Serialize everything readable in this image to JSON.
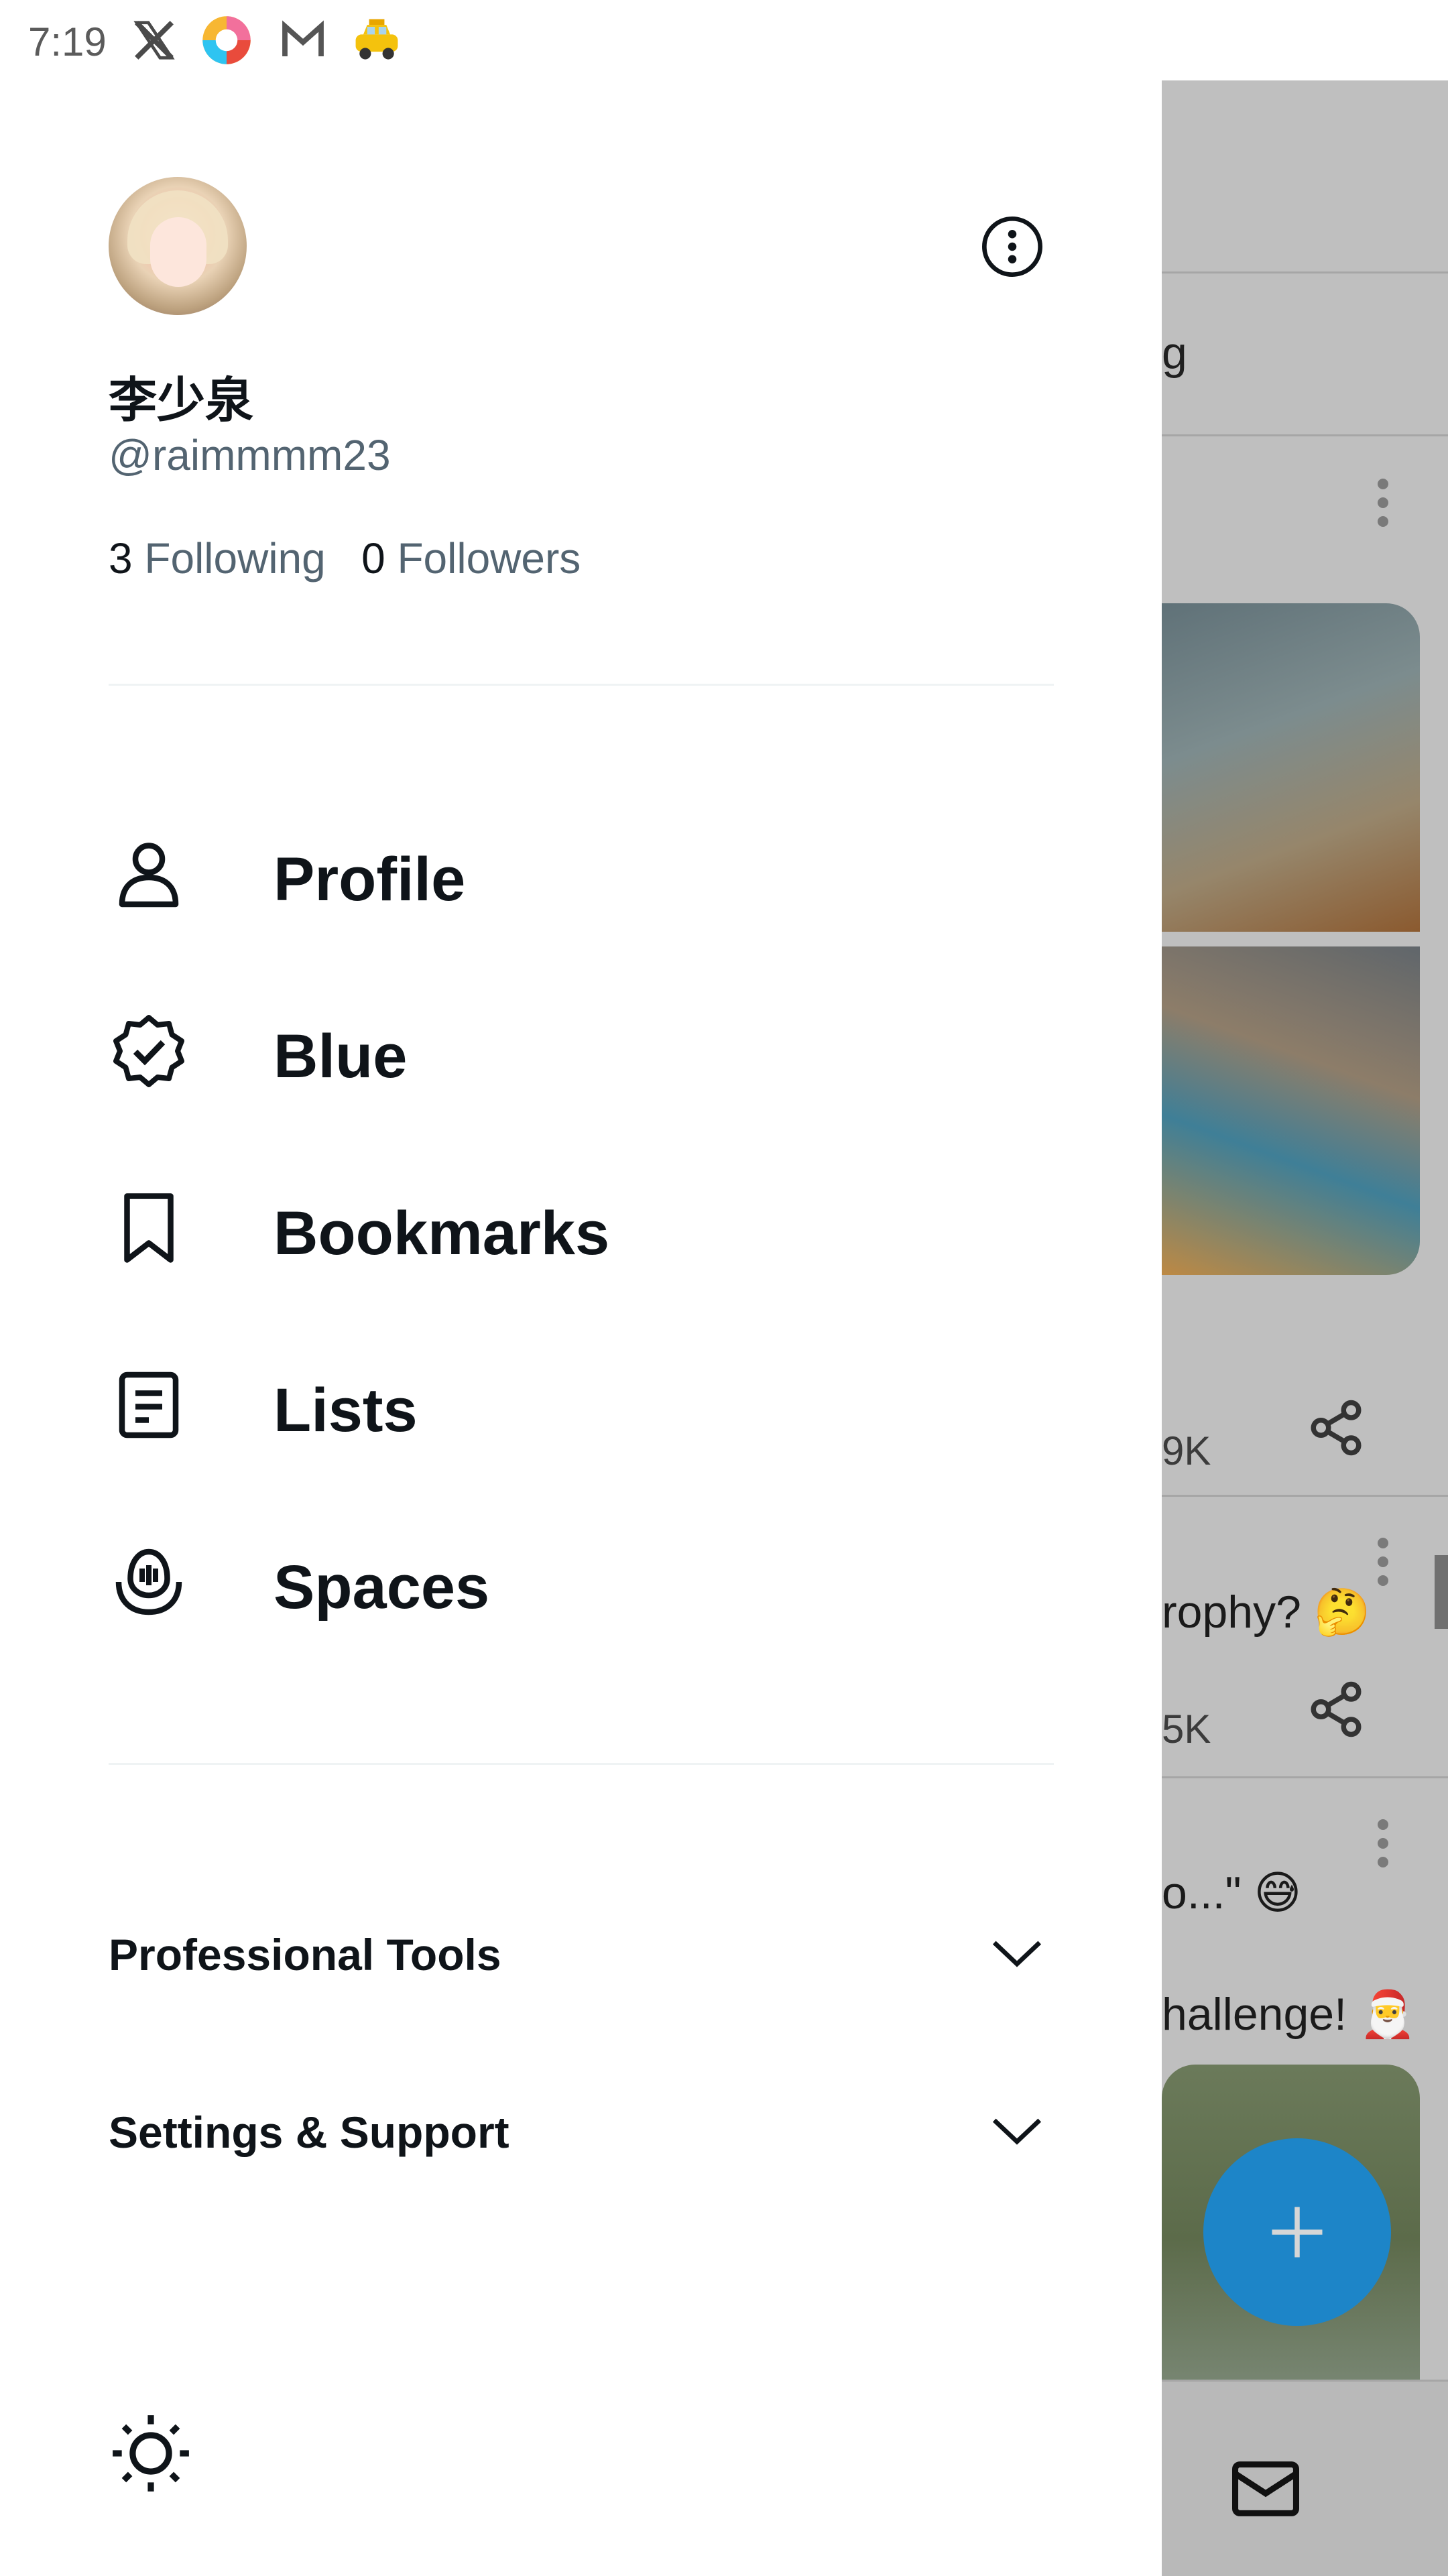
{
  "status_bar": {
    "time": "7:19",
    "icons": [
      "x-app-icon",
      "colorful-app-icon",
      "gmail-style-icon",
      "taxi-icon"
    ]
  },
  "drawer": {
    "profile": {
      "display_name": "李少泉",
      "handle": "@raimmmm23",
      "following_count": "3",
      "following_label": "Following",
      "followers_count": "0",
      "followers_label": "Followers"
    },
    "menu": [
      {
        "label": "Profile",
        "icon": "person-icon"
      },
      {
        "label": "Blue",
        "icon": "verified-badge-icon"
      },
      {
        "label": "Bookmarks",
        "icon": "bookmark-icon"
      },
      {
        "label": "Lists",
        "icon": "list-icon"
      },
      {
        "label": "Spaces",
        "icon": "spaces-icon"
      }
    ],
    "sections": [
      {
        "label": "Professional Tools",
        "icon": "chevron-down-icon"
      },
      {
        "label": "Settings & Support",
        "icon": "chevron-down-icon"
      }
    ],
    "footer_icon": "sun-icon"
  },
  "background_app": {
    "tab_fragment": "g",
    "stat_fragment_1": "9K",
    "tweet_fragment_1": "rophy? 🤔",
    "stat_fragment_2": "5K",
    "tweet_fragment_2": "o...\" 😅",
    "tweet_fragment_3": "hallenge! 🎅"
  },
  "colors": {
    "accent": "#1d9bf0",
    "fab": "#1d85c8",
    "text_primary": "#0f1419",
    "text_secondary": "#536471",
    "divider": "#eff3f4"
  }
}
